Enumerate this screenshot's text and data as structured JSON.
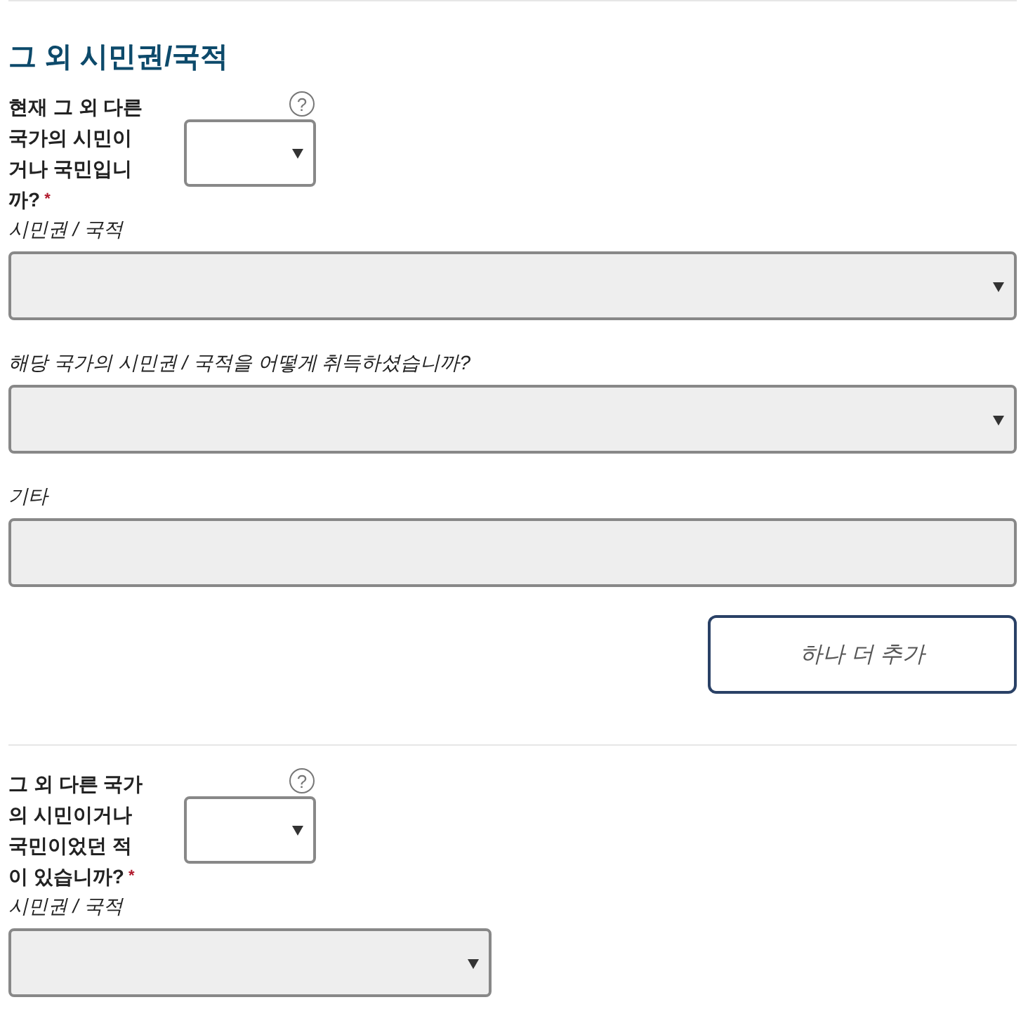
{
  "sections": [
    {
      "heading": "그 외 시민권/국적",
      "question": {
        "label": "현재 그 외 다른 국가의 시민이거나 국민입니까?",
        "required_mark": "*",
        "help": "?"
      },
      "fields": [
        {
          "kind": "select",
          "label": "시민권 / 국적"
        },
        {
          "kind": "select",
          "label": "해당 국가의 시민권 / 국적을 어떻게 취득하셨습니까?"
        },
        {
          "kind": "text",
          "label": "기타"
        }
      ],
      "button": "하나 더 추가"
    },
    {
      "question": {
        "label": "그 외 다른 국가의 시민이거나 국민이었던 적이 있습니까?",
        "required_mark": "*",
        "help": "?"
      },
      "fields": [
        {
          "kind": "shortselect",
          "label": "시민권 / 국적"
        }
      ]
    }
  ]
}
